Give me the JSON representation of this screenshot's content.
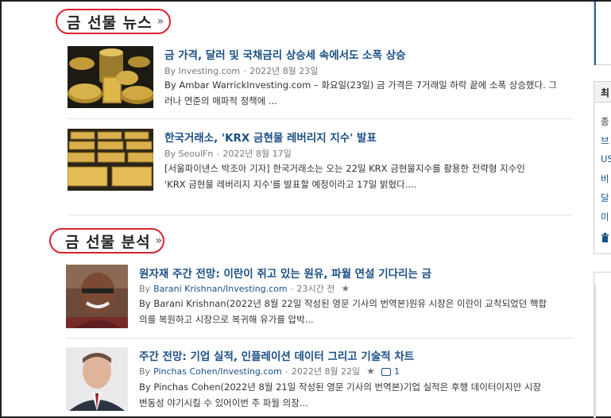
{
  "sections": {
    "news": {
      "title": "금 선물 뉴스",
      "more": "»",
      "articles": [
        {
          "title": "금 가격, 달러 및 국채금리 상승세 속에서도 소폭 상승",
          "source": "By Investing.com",
          "sep": "-",
          "date": "2022년 8월 23일",
          "snippet_line1": "By Ambar WarrickInvesting.com – 화요일(23일) 금 가격은 7거래일 하락 끝에 소폭 상승했다. 그",
          "snippet_line2": "러나 연준의 매파적 정책에 ..."
        },
        {
          "title": "한국거래소, 'KRX 금현물 레버리지 지수' 발표",
          "source": "By SeoulFn",
          "sep": "-",
          "date": "2022년 8월 17일",
          "snippet_line1": "[서울파이낸스 박조아 기자] 한국거래소는 오는 22일 KRX 금현물지수를 활용한 전략형 지수인",
          "snippet_line2": "'KRX 금현물 레버리지 지수'를 발표할 예정이라고 17일 밝혔다...."
        }
      ]
    },
    "analysis": {
      "title": "금 선물 분석",
      "more": "»",
      "articles": [
        {
          "title": "원자재 주간 전망: 이란이 쥐고 있는 원유, 파월 연설 기다리는 금",
          "source": "By",
          "author": "Barani Krishnan/Investing.com",
          "sep": "-",
          "date": "23시간 전",
          "snippet_line1": "By Barani Krishnan(2022년 8월 22일 작성된 영문 기사의 번역본)원유 시장은 이란이 교착되었던 핵합",
          "snippet_line2": "의를 복원하고 시장으로 복귀해 유가를 압박..."
        },
        {
          "title": "주간 전망: 기업 실적, 인플레이션 데이터 그리고 기술적 차트",
          "source": "By",
          "author": "Pinchas Cohen/Investing.com",
          "sep": "-",
          "date": "2022년 8월 22일",
          "comments": "1",
          "snippet_line1": "By Pinchas Cohen(2022년 8월 21일 작성된 영문 기사의 번역본)기업 실적은 후행 데이터이지만 시장",
          "snippet_line2": "변동성 야기시킬 수 있어이번 주 파월 의장..."
        }
      ]
    }
  },
  "right_panel": {
    "header": "최",
    "items": [
      "종",
      "브",
      "US",
      "비",
      "달",
      "미"
    ]
  },
  "colors": {
    "link": "#1a4f85",
    "highlight_ring": "#d9232d",
    "meta": "#777777"
  }
}
